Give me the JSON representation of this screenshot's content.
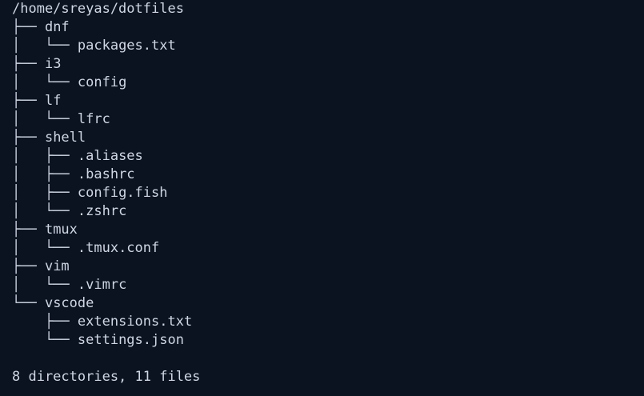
{
  "terminal": {
    "root_path": "/home/sreyas/dotfiles",
    "tree": [
      {
        "prefix": "├── ",
        "name": "dnf"
      },
      {
        "prefix": "│   └── ",
        "name": "packages.txt"
      },
      {
        "prefix": "├── ",
        "name": "i3"
      },
      {
        "prefix": "│   └── ",
        "name": "config"
      },
      {
        "prefix": "├── ",
        "name": "lf"
      },
      {
        "prefix": "│   └── ",
        "name": "lfrc"
      },
      {
        "prefix": "├── ",
        "name": "shell"
      },
      {
        "prefix": "│   ├── ",
        "name": ".aliases"
      },
      {
        "prefix": "│   ├── ",
        "name": ".bashrc"
      },
      {
        "prefix": "│   ├── ",
        "name": "config.fish"
      },
      {
        "prefix": "│   └── ",
        "name": ".zshrc"
      },
      {
        "prefix": "├── ",
        "name": "tmux"
      },
      {
        "prefix": "│   └── ",
        "name": ".tmux.conf"
      },
      {
        "prefix": "├── ",
        "name": "vim"
      },
      {
        "prefix": "│   └── ",
        "name": ".vimrc"
      },
      {
        "prefix": "└── ",
        "name": "vscode"
      },
      {
        "prefix": "    ├── ",
        "name": "extensions.txt"
      },
      {
        "prefix": "    └── ",
        "name": "settings.json"
      }
    ],
    "summary": "8 directories, 11 files"
  }
}
